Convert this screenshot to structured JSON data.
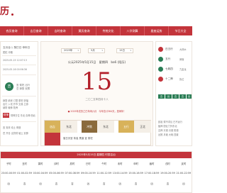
{
  "brand": {
    "text": "历"
  },
  "nav": [
    "农历查询",
    "吉日查询",
    "吉时查询",
    "黄历查询",
    "传统文化",
    "八字测算",
    "星座运势",
    "节日大全"
  ],
  "left": {
    "line1": "五月廿八 癸巳日 申年日",
    "line1b": "属蛇 冲猪",
    "time1": "2025-05-15 12:07:13",
    "time2": "2025-05-16 00:56:36",
    "badge": "吉",
    "badge_text": [
      "宜 祭祀 出行",
      "忌 嫁娶 安葬"
    ],
    "mid_lines": [
      "嫁娶 纳采 订盟 祭祀 祈福",
      "出行 入宅 开市 交易 立券",
      "纳财 栽种 牧养"
    ],
    "tag1": "财神",
    "tag1_text": "财神方位 东北 喜神 西北",
    "bottom_lines": [
      "宜 安床 动土 修造",
      "忌 开仓 出货财 破土 安葬"
    ]
  },
  "center": {
    "year": "2025年",
    "month": "5月",
    "day": "15日",
    "date_line": "公元2025年5月15日　星期四　ba6 (阳历)",
    "big_day": "15",
    "lunar_sub": "二〇二五年四月十八",
    "festival": "● 2025年农历乙巳年闰六月　今年总计384天，是闰年！",
    "labels": [
      "凶吉",
      "冲煞",
      "五行"
    ],
    "values": [
      "东北",
      "东北",
      "正北"
    ],
    "note": "值日天官 朱雀 黑道 宜 祭祀"
  },
  "right": {
    "items": [
      "日五行",
      "五行",
      "七政四",
      "十二神"
    ],
    "smalls": [
      "大林木",
      "房宿",
      "亢金龙",
      "执位"
    ],
    "tags": [
      "吉",
      "凶",
      "吉",
      "吉",
      "凶"
    ],
    "lines": [
      "彭祖 癸不词讼 巳不远行",
      "胎神 厨灶门外东北",
      "吉神 天德 月德 阳德",
      "凶煞 月破 大耗 四废"
    ]
  },
  "bottom": {
    "head": "2025年5月15日 星期四 时辰吉凶",
    "hours": [
      "子时",
      "丑时",
      "寅时",
      "卯时",
      "辰时",
      "巳时",
      "午时",
      "未时",
      "申时",
      "酉时",
      "戌时",
      "亥时"
    ],
    "ranges": [
      "23:00-00:59",
      "01:00-02:59",
      "03:00-04:59",
      "05:00-06:59",
      "07:00-08:59",
      "09:00-10:59",
      "11:00-12:59",
      "13:00-14:59",
      "15:00-16:59",
      "17:00-18:59",
      "19:00-20:59",
      "21:00-22:59"
    ],
    "luck": [
      "凶",
      "吉",
      "凶",
      "吉",
      "吉",
      "凶",
      "吉",
      "凶",
      "吉",
      "凶",
      "吉",
      "凶"
    ]
  },
  "colors": {
    "accent": "#c3343b",
    "green": "#2a7d55",
    "gold": "#d8b25a",
    "brown": "#8a6a3c"
  }
}
